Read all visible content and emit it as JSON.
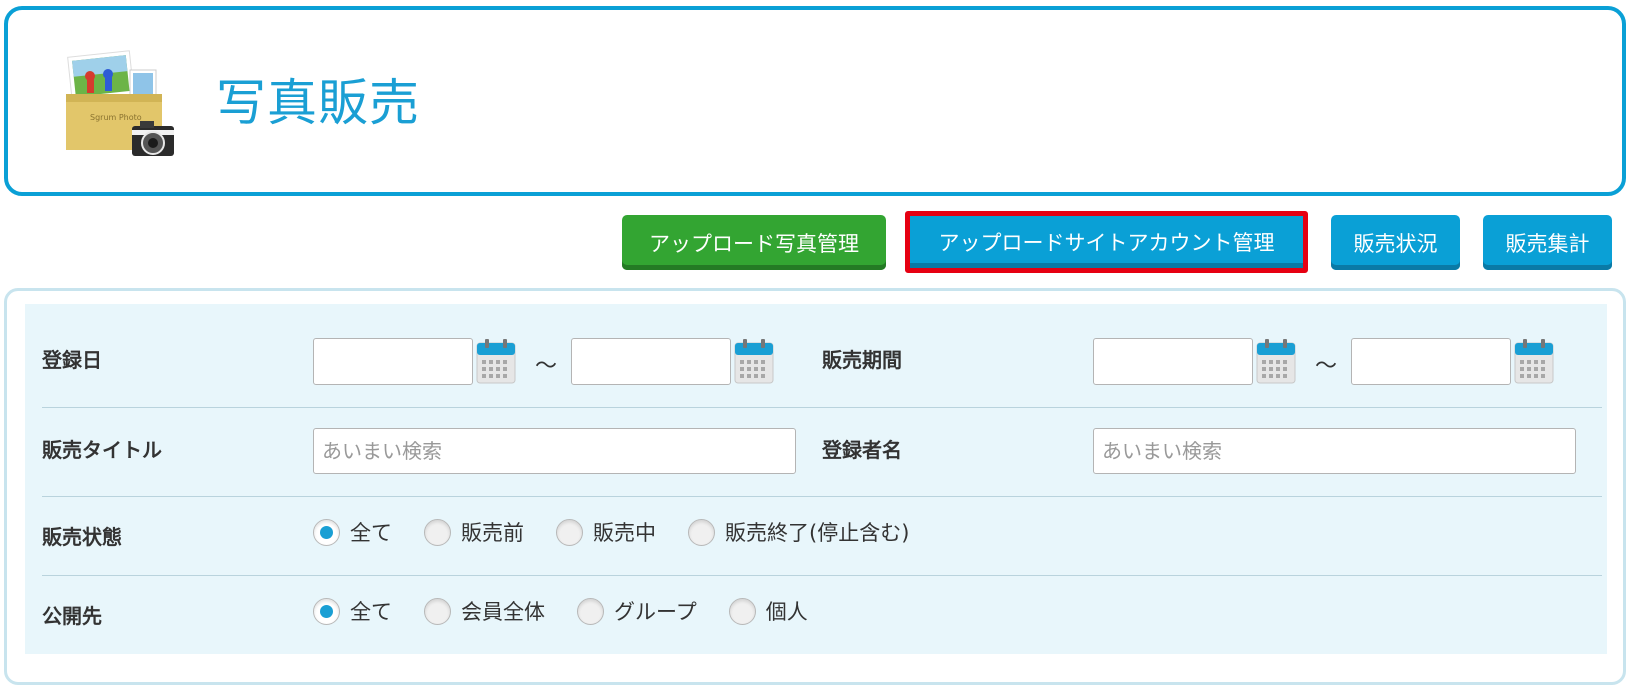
{
  "header": {
    "title": "写真販売",
    "logo_text": "Sgrum Photo"
  },
  "nav_buttons": {
    "upload_photo_mgmt": "アップロード写真管理",
    "upload_site_account_mgmt": "アップロードサイトアカウント管理",
    "sales_status": "販売状況",
    "sales_summary": "販売集計"
  },
  "search_form": {
    "registration_date": {
      "label": "登録日",
      "from_value": "",
      "to_value": "",
      "separator": "～"
    },
    "sales_period": {
      "label": "販売期間",
      "from_value": "",
      "to_value": "",
      "separator": "～"
    },
    "sales_title": {
      "label": "販売タイトル",
      "value": "",
      "placeholder": "あいまい検索"
    },
    "registrant_name": {
      "label": "登録者名",
      "value": "",
      "placeholder": "あいまい検索"
    },
    "sales_state": {
      "label": "販売状態",
      "options": [
        "全て",
        "販売前",
        "販売中",
        "販売終了(停止含む)"
      ],
      "selected": "全て"
    },
    "publish_to": {
      "label": "公開先",
      "options": [
        "全て",
        "会員全体",
        "グループ",
        "個人"
      ],
      "selected": "全て"
    }
  },
  "colors": {
    "accent_blue": "#0aa0d6",
    "button_green": "#33a532",
    "highlight_red": "#e60012",
    "form_background": "#e8f6fb"
  },
  "icons": {
    "logo": "photo-folder-camera-icon",
    "date_picker": "calendar-icon",
    "radio": "radio-button"
  }
}
